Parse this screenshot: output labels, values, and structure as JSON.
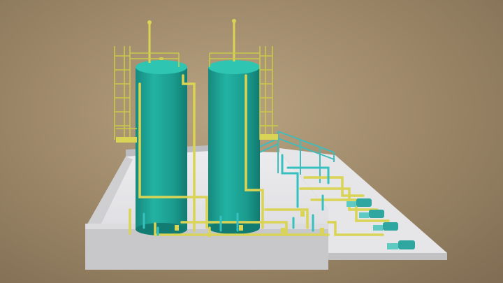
{
  "scene": {
    "subject": "industrial-tank-plant-3d-model",
    "colors": {
      "background_light": "#b8a382",
      "background_dark": "#7f6c52",
      "tank_body": "#1fa596",
      "tank_top": "#2ec5b3",
      "railing": "#c9c94a",
      "pipe_yellow": "#d9d455",
      "pipe_cyan": "#36c1c0",
      "concrete_slab": "#e7e7e9",
      "concrete_wall": "#c9c9cc",
      "pump_body": "#2fa7a0"
    },
    "tanks": [
      {
        "name": "left-tank"
      },
      {
        "name": "right-tank"
      }
    ],
    "pump_count": 4
  }
}
